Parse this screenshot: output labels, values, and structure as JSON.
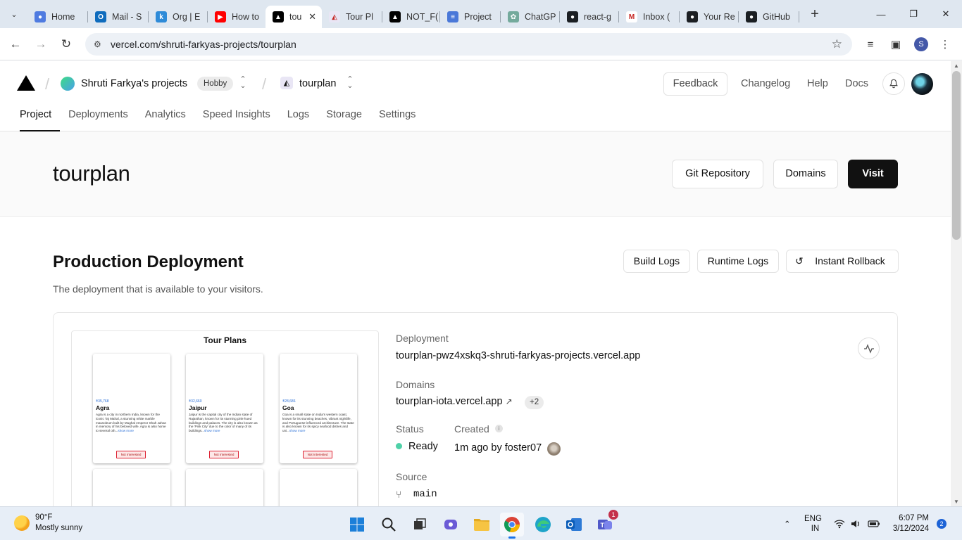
{
  "browser": {
    "tabs": [
      {
        "title": "Home",
        "fav": "#4f7be0",
        "glyph": "●"
      },
      {
        "title": "Mail - S",
        "fav": "#0f6cbd",
        "glyph": "O"
      },
      {
        "title": "Org | E",
        "fav": "#2e8bd8",
        "glyph": "k"
      },
      {
        "title": "How to",
        "fav": "#ff0000",
        "glyph": "▶"
      },
      {
        "title": "tou",
        "fav": "#000000",
        "glyph": "▲"
      },
      {
        "title": "Tour Pl",
        "fav": "#e9e6f5",
        "glyph": "◭"
      },
      {
        "title": "NOT_F(",
        "fav": "#000000",
        "glyph": "▲"
      },
      {
        "title": "Project",
        "fav": "#4a78d8",
        "glyph": "≡"
      },
      {
        "title": "ChatGP",
        "fav": "#74aa9c",
        "glyph": "✿"
      },
      {
        "title": "react-g",
        "fav": "#1b1f23",
        "glyph": "●"
      },
      {
        "title": "Inbox (",
        "fav": "#ffffff",
        "glyph": "M"
      },
      {
        "title": "Your Re",
        "fav": "#1b1f23",
        "glyph": "●"
      },
      {
        "title": "GitHub",
        "fav": "#1b1f23",
        "glyph": "●"
      }
    ],
    "url": "vercel.com/shruti-farkyas-projects/tourplan",
    "profile_initial": "S"
  },
  "header": {
    "team_name": "Shruti Farkya's projects",
    "plan_badge": "Hobby",
    "project_name": "tourplan",
    "feedback": "Feedback",
    "changelog": "Changelog",
    "help": "Help",
    "docs": "Docs"
  },
  "nav": {
    "tabs": [
      "Project",
      "Deployments",
      "Analytics",
      "Speed Insights",
      "Logs",
      "Storage",
      "Settings"
    ]
  },
  "hero": {
    "title": "tourplan",
    "git_repository": "Git Repository",
    "domains": "Domains",
    "visit": "Visit"
  },
  "production": {
    "title": "Production Deployment",
    "subtitle": "The deployment that is available to your visitors.",
    "build_logs": "Build Logs",
    "runtime_logs": "Runtime Logs",
    "instant_rollback": "Instant Rollback",
    "deployment_label": "Deployment",
    "deployment_url": "tourplan-pwz4xskq3-shruti-farkyas-projects.vercel.app",
    "domains_label": "Domains",
    "domain": "tourplan-iota.vercel.app",
    "domain_more": "+2",
    "status_label": "Status",
    "status": "Ready",
    "created_label": "Created",
    "created": "1m ago by foster07",
    "source_label": "Source",
    "branch": "main"
  },
  "preview": {
    "title": "Tour Plans",
    "cities": [
      {
        "price": "₹35,768",
        "name": "Agra",
        "desc": "Agra is a city in northern India, known for the iconic Taj Mahal, a stunning white marble mausoleum built by Mughal emperor Shah Jahan in memory of his beloved wife. Agra is also home to several oth...",
        "more": "show more",
        "button": "Not Interested"
      },
      {
        "price": "₹32,660",
        "name": "Jaipur",
        "desc": "Jaipur is the capital city of the Indian state of Rajasthan, known for its stunning pink-hued buildings and palaces. The city is also known as the 'Pink City' due to the color of many of its buildings...",
        "more": "show more",
        "button": "Not Interested"
      },
      {
        "price": "₹28,686",
        "name": "Goa",
        "desc": "Goa is a small state on India's western coast, known for its stunning beaches, vibrant nightlife, and Portuguese-influenced architecture. The state is also known for its spicy seafood dishes and uni...",
        "more": "show more",
        "button": "Not Interested"
      }
    ]
  },
  "taskbar": {
    "temp": "90°F",
    "weather": "Mostly sunny",
    "lang1": "ENG",
    "lang2": "IN",
    "time": "6:07 PM",
    "date": "3/12/2024",
    "notifications": "2",
    "teams_badge": "1"
  }
}
